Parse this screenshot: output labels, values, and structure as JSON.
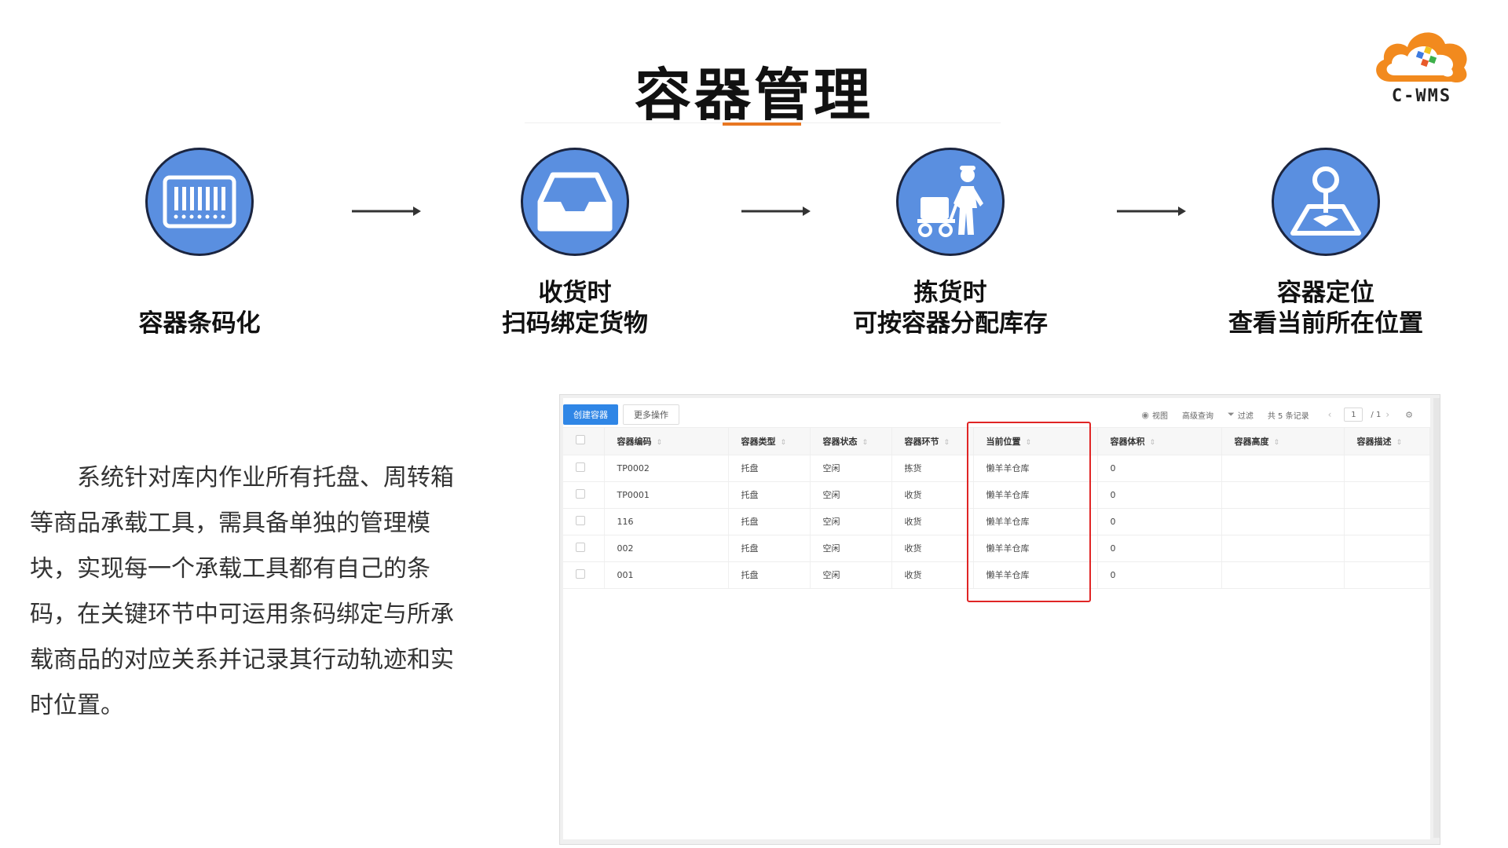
{
  "page_title": "容器管理",
  "logo": {
    "text": "C-WMS"
  },
  "steps": [
    {
      "icon": "barcode-icon",
      "lines": [
        "容器条码化"
      ]
    },
    {
      "icon": "inbox-tray-icon",
      "lines": [
        "收货时",
        "扫码绑定货物"
      ]
    },
    {
      "icon": "worker-cart-icon",
      "lines": [
        "拣货时",
        "可按容器分配库存"
      ]
    },
    {
      "icon": "location-pin-icon",
      "lines": [
        "容器定位",
        "查看当前所在位置"
      ]
    }
  ],
  "description": "系统针对库内作业所有托盘、周转箱等商品承载工具，需具备单独的管理模块，实现每一个承载工具都有自己的条码，在关键环节中可运用条码绑定与所承载商品的对应关系并记录其行动轨迹和实时位置。",
  "toolbar": {
    "create_label": "创建容器",
    "more_label": "更多操作",
    "view_label": "视图",
    "advanced_query_label": "高级查询",
    "filter_label": "过滤",
    "record_count": "共 5 条记录",
    "current_page": "1",
    "total_pages": "/ 1"
  },
  "table": {
    "columns": [
      "容器编码",
      "容器类型",
      "容器状态",
      "容器环节",
      "当前位置",
      "容器体积",
      "容器高度",
      "容器描述"
    ],
    "rows": [
      [
        "TP0002",
        "托盘",
        "空闲",
        "拣货",
        "懒羊羊仓库",
        "0",
        "",
        ""
      ],
      [
        "TP0001",
        "托盘",
        "空闲",
        "收货",
        "懒羊羊仓库",
        "0",
        "",
        ""
      ],
      [
        "116",
        "托盘",
        "空闲",
        "收货",
        "懒羊羊仓库",
        "0",
        "",
        ""
      ],
      [
        "002",
        "托盘",
        "空闲",
        "收货",
        "懒羊羊仓库",
        "0",
        "",
        ""
      ],
      [
        "001",
        "托盘",
        "空闲",
        "收货",
        "懒羊羊仓库",
        "0",
        "",
        ""
      ]
    ]
  },
  "colors": {
    "accent": "#e87722",
    "icon_blue": "#5a8fe0",
    "primary_button": "#2f86e6",
    "highlight": "#e02525"
  }
}
